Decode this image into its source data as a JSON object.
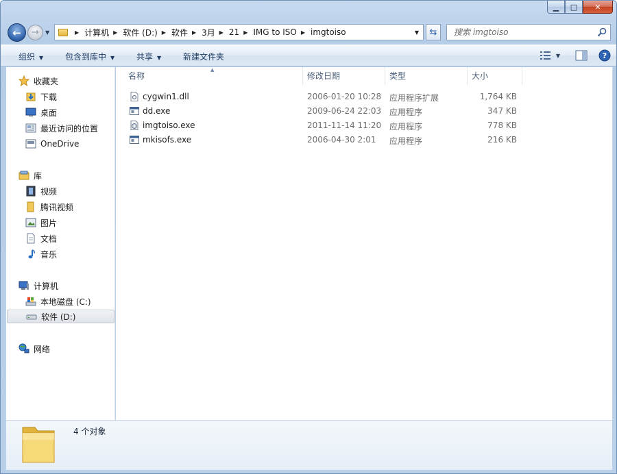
{
  "window": {
    "caption": {
      "minimize_icon": "minimize-icon",
      "maximize_icon": "maximize-icon",
      "close_icon": "close-icon"
    }
  },
  "address": {
    "crumbs": [
      "计算机",
      "软件 (D:)",
      "软件",
      "3月",
      "21",
      "IMG to ISO",
      "imgtoiso"
    ]
  },
  "search": {
    "placeholder": "搜索 imgtoiso"
  },
  "toolbar": {
    "organize": "组织",
    "include_in_library": "包含到库中",
    "share": "共享",
    "new_folder": "新建文件夹"
  },
  "nav": {
    "favorites": {
      "label": "收藏夹",
      "items": [
        "下载",
        "桌面",
        "最近访问的位置",
        "OneDrive"
      ]
    },
    "libraries": {
      "label": "库",
      "items": [
        "视频",
        "腾讯视频",
        "图片",
        "文档",
        "音乐"
      ]
    },
    "computer": {
      "label": "计算机",
      "items": [
        "本地磁盘 (C:)",
        "软件 (D:)"
      ]
    },
    "network": {
      "label": "网络"
    },
    "selected": "软件 (D:)"
  },
  "columns": {
    "name": "名称",
    "modified": "修改日期",
    "type": "类型",
    "size": "大小"
  },
  "files": [
    {
      "name": "cygwin1.dll",
      "modified": "2006-01-20 10:28",
      "type": "应用程序扩展",
      "size": "1,764 KB",
      "icon": "dll-file-icon"
    },
    {
      "name": "dd.exe",
      "modified": "2009-06-24 22:03",
      "type": "应用程序",
      "size": "347 KB",
      "icon": "exe-file-icon"
    },
    {
      "name": "imgtoiso.exe",
      "modified": "2011-11-14 11:20",
      "type": "应用程序",
      "size": "778 KB",
      "icon": "disc-exe-icon"
    },
    {
      "name": "mkisofs.exe",
      "modified": "2006-04-30 2:01",
      "type": "应用程序",
      "size": "216 KB",
      "icon": "exe-file-icon"
    }
  ],
  "details": {
    "count": "4 个对象"
  },
  "colors": {
    "accent": "#2c5fa8",
    "selection": "#dfe3e9",
    "frame": "#b9d0ea"
  }
}
